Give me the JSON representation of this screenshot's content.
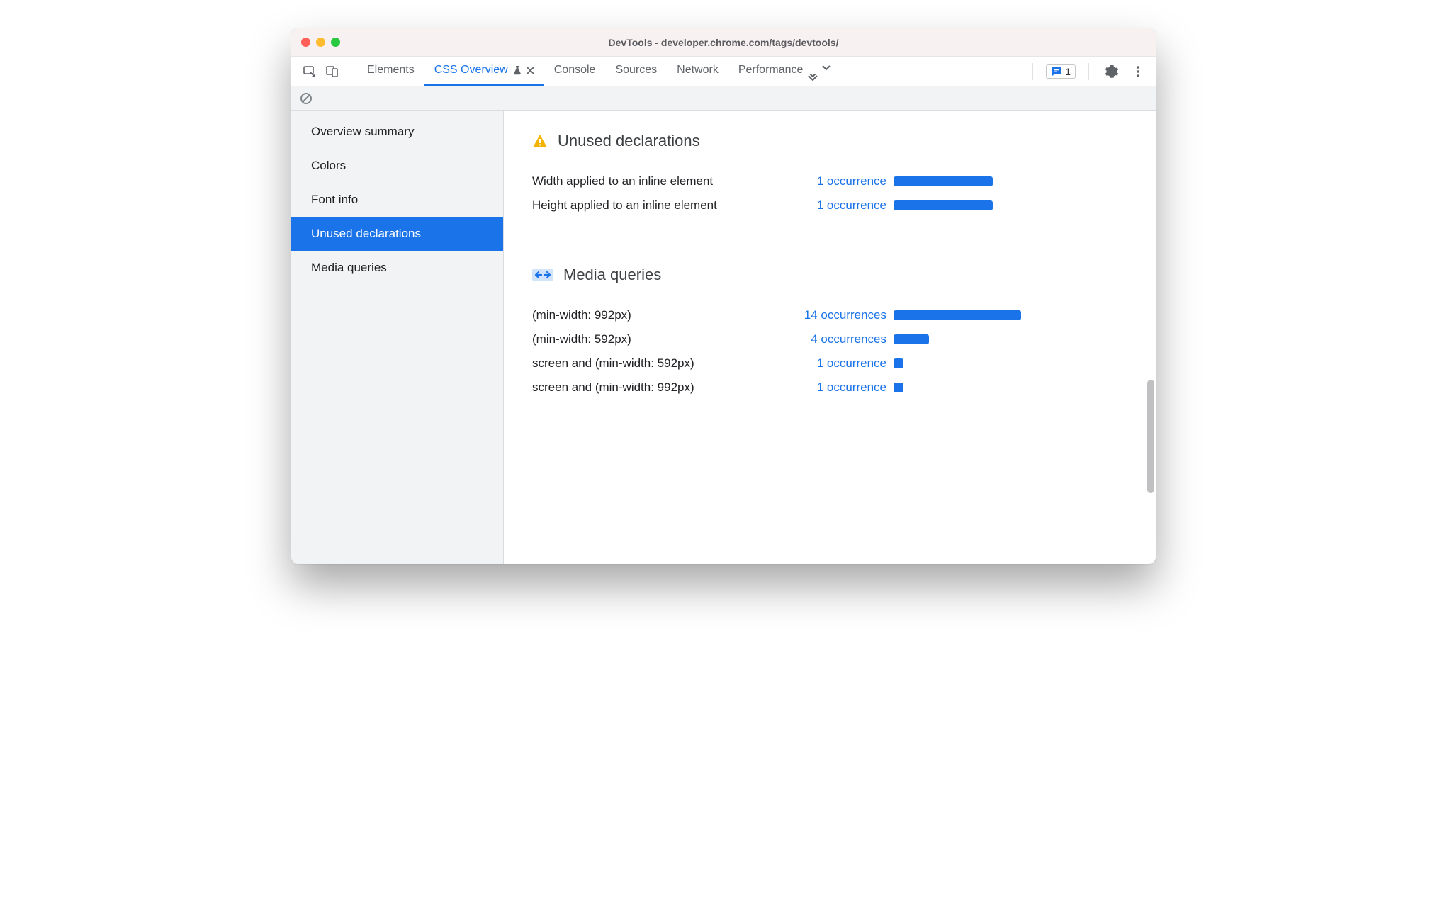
{
  "window": {
    "title": "DevTools - developer.chrome.com/tags/devtools/"
  },
  "tabs": {
    "items": [
      "Elements",
      "CSS Overview",
      "Console",
      "Sources",
      "Network",
      "Performance"
    ],
    "active_index": 1
  },
  "badge": {
    "count": "1"
  },
  "sidebar": {
    "items": [
      "Overview summary",
      "Colors",
      "Font info",
      "Unused declarations",
      "Media queries"
    ],
    "selected_index": 3
  },
  "sections": {
    "unused": {
      "title": "Unused declarations",
      "rows": [
        {
          "label": "Width applied to an inline element",
          "link": "1 occurrence",
          "bar_pct": 78
        },
        {
          "label": "Height applied to an inline element",
          "link": "1 occurrence",
          "bar_pct": 78
        }
      ]
    },
    "media": {
      "title": "Media queries",
      "rows": [
        {
          "label": "(min-width: 992px)",
          "link": "14 occurrences",
          "bar_pct": 100
        },
        {
          "label": "(min-width: 592px)",
          "link": "4 occurrences",
          "bar_pct": 28
        },
        {
          "label": "screen and (min-width: 592px)",
          "link": "1 occurrence",
          "bar_pct": 8
        },
        {
          "label": "screen and (min-width: 992px)",
          "link": "1 occurrence",
          "bar_pct": 8
        }
      ]
    }
  }
}
